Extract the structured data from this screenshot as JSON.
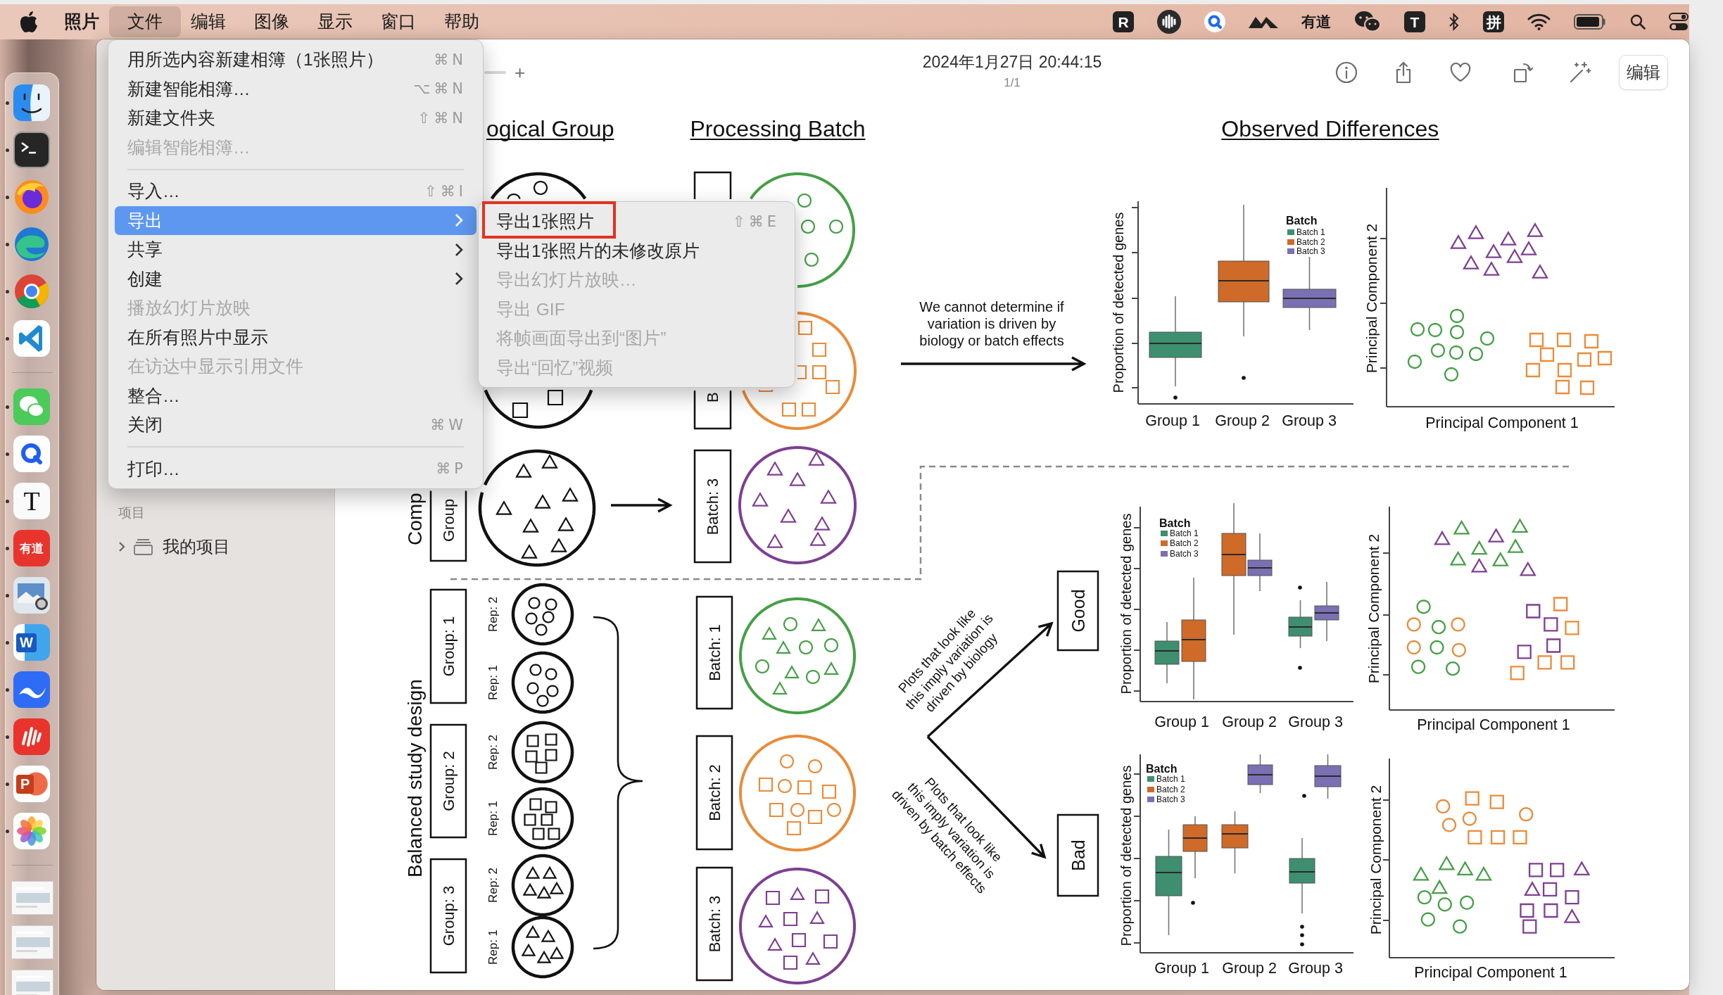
{
  "menu_bar": {
    "menus": [
      {
        "label": "照片",
        "kind": "app",
        "selected": false
      },
      {
        "label": "文件",
        "kind": "menu",
        "selected": true
      },
      {
        "label": "编辑",
        "kind": "menu",
        "selected": false
      },
      {
        "label": "图像",
        "kind": "menu",
        "selected": false
      },
      {
        "label": "显示",
        "kind": "menu",
        "selected": false
      },
      {
        "label": "窗口",
        "kind": "menu",
        "selected": false
      },
      {
        "label": "帮助",
        "kind": "menu",
        "selected": false
      }
    ],
    "status_texts": [
      "R",
      "有道",
      "T",
      "拼"
    ]
  },
  "dock": {
    "items": [
      {
        "running": true
      },
      {
        "running": true
      },
      {
        "running": true
      },
      {
        "running": true
      },
      {
        "running": true
      },
      {
        "running": true
      },
      {
        "running": true
      },
      {
        "running": true
      },
      {
        "running": true,
        "glyph": "T"
      },
      {
        "running": true,
        "glyph": "有道"
      },
      {
        "running": true
      },
      {
        "running": true,
        "glyph": "W"
      },
      {
        "running": true
      },
      {
        "running": true
      },
      {
        "running": true,
        "glyph": "P"
      },
      {
        "running": true
      }
    ]
  },
  "file_menu": {
    "items": [
      {
        "kind": "item",
        "label": "用所选内容新建相簿（1张照片）",
        "shortcut": "⌘N",
        "disabled": false,
        "selected": false,
        "submenu": false
      },
      {
        "kind": "item",
        "label": "新建智能相簿…",
        "shortcut": "⌥⌘N",
        "disabled": false,
        "selected": false,
        "submenu": false
      },
      {
        "kind": "item",
        "label": "新建文件夹",
        "shortcut": "⇧⌘N",
        "disabled": false,
        "selected": false,
        "submenu": false
      },
      {
        "kind": "item",
        "label": "编辑智能相簿…",
        "disabled": true,
        "selected": false,
        "submenu": false
      },
      {
        "kind": "separator"
      },
      {
        "kind": "item",
        "label": "导入…",
        "shortcut": "⇧⌘I",
        "disabled": false,
        "selected": false,
        "submenu": false
      },
      {
        "kind": "item",
        "label": "导出",
        "disabled": false,
        "selected": true,
        "submenu": true
      },
      {
        "kind": "item",
        "label": "共享",
        "disabled": false,
        "selected": false,
        "submenu": true
      },
      {
        "kind": "item",
        "label": "创建",
        "disabled": false,
        "selected": false,
        "submenu": true
      },
      {
        "kind": "item",
        "label": "播放幻灯片放映",
        "disabled": true,
        "selected": false,
        "submenu": false
      },
      {
        "kind": "item",
        "label": "在所有照片中显示",
        "disabled": false,
        "selected": false,
        "submenu": false
      },
      {
        "kind": "item",
        "label": "在访达中显示引用文件",
        "disabled": true,
        "selected": false,
        "submenu": false
      },
      {
        "kind": "item",
        "label": "整合…",
        "disabled": false,
        "selected": false,
        "submenu": false
      },
      {
        "kind": "item",
        "label": "关闭",
        "shortcut": "⌘W",
        "disabled": false,
        "selected": false,
        "submenu": false
      },
      {
        "kind": "separator"
      },
      {
        "kind": "item",
        "label": "打印…",
        "shortcut": "⌘P",
        "disabled": false,
        "selected": false,
        "submenu": false
      }
    ]
  },
  "export_submenu": {
    "items": [
      {
        "label": "导出1张照片",
        "shortcut": "⇧⌘E",
        "disabled": false,
        "selected": false,
        "outlined": true
      },
      {
        "label": "导出1张照片的未修改原片",
        "disabled": false,
        "selected": false,
        "outlined": false
      },
      {
        "label": "导出幻灯片放映…",
        "disabled": true,
        "selected": false,
        "outlined": false
      },
      {
        "label": "导出 GIF",
        "disabled": true,
        "selected": false,
        "outlined": false
      },
      {
        "label": "将帧画面导出到“图片”",
        "disabled": true,
        "selected": false,
        "outlined": false
      },
      {
        "label": "导出“回忆”视频",
        "disabled": true,
        "selected": false,
        "outlined": false
      }
    ]
  },
  "sidebar": {
    "sections": [
      {
        "title": "项目",
        "items": [
          {
            "label": "我的项目",
            "expanded": false
          }
        ]
      }
    ]
  },
  "toolbar": {
    "zoom_in": "+",
    "date": "2024年1月27日 20:44:15",
    "counter": "1/1",
    "favorite": false,
    "edit_button": "编辑"
  },
  "figure": {
    "titles": [
      "ogical Group",
      "Processing Batch",
      "Observed Differences"
    ],
    "confounded_design": {
      "label": "Comp",
      "group_label": "Group",
      "batch_labels": [
        "B",
        "Batch: 3"
      ]
    },
    "balanced_design": {
      "label": "Balanced study design",
      "groups": [
        {
          "label": "Group: 1",
          "replicates": [
            "Rep: 2",
            "Rep: 1"
          ]
        },
        {
          "label": "Group: 2",
          "replicates": [
            "Rep: 2",
            "Rep: 1"
          ]
        },
        {
          "label": "Group: 3",
          "replicates": [
            "Rep: 2",
            "Rep: 1"
          ]
        }
      ],
      "batch_labels": [
        "Batch: 1",
        "Batch: 2",
        "Batch: 3"
      ]
    },
    "confounded_note": [
      "We cannot determine if",
      "variation is driven by",
      "biology or batch effects"
    ],
    "branch_notes": [
      [
        "Plots that look like",
        "this imply variation is",
        "driven by biology"
      ],
      [
        "Plots that look like",
        "this imply variation is",
        "driven by batch effects"
      ]
    ],
    "outcomes": [
      "Good",
      "Bad"
    ],
    "chart_rows": [
      {
        "boxplot": {
          "ylabel": "Proportion of detected genes",
          "categories": [
            "Group 1",
            "Group 2",
            "Group 3"
          ],
          "legend": {
            "title": "Batch",
            "items": [
              {
                "label": "Batch 1",
                "color": "#3d8f70"
              },
              {
                "label": "Batch 2",
                "color": "#cf6a28"
              },
              {
                "label": "Batch 3",
                "color": "#7a70b3"
              }
            ]
          }
        },
        "pca": {
          "xlabel": "Principal Component 1",
          "ylabel": "Principal Component 2"
        }
      },
      {
        "boxplot": {
          "ylabel": "Proportion of detected genes",
          "categories": [
            "Group 1",
            "Group 2",
            "Group 3"
          ],
          "legend": {
            "title": "Batch",
            "items": [
              {
                "label": "Batch 1",
                "color": "#3d8f70"
              },
              {
                "label": "Batch 2",
                "color": "#cf6a28"
              },
              {
                "label": "Batch 3",
                "color": "#7a70b3"
              }
            ]
          }
        },
        "pca": {
          "xlabel": "Principal Component 1",
          "ylabel": "Principal Component 2"
        }
      },
      {
        "boxplot": {
          "ylabel": "Proportion of detected genes",
          "categories": [
            "Group 1",
            "Group 2",
            "Group 3"
          ],
          "legend": {
            "title": "Batch",
            "items": [
              {
                "label": "Batch 1",
                "color": "#3d8f70"
              },
              {
                "label": "Batch 2",
                "color": "#cf6a28"
              },
              {
                "label": "Batch 3",
                "color": "#7a70b3"
              }
            ]
          }
        },
        "pca": {
          "xlabel": "Principal Component 1",
          "ylabel": "Principal Component 2"
        }
      }
    ]
  }
}
